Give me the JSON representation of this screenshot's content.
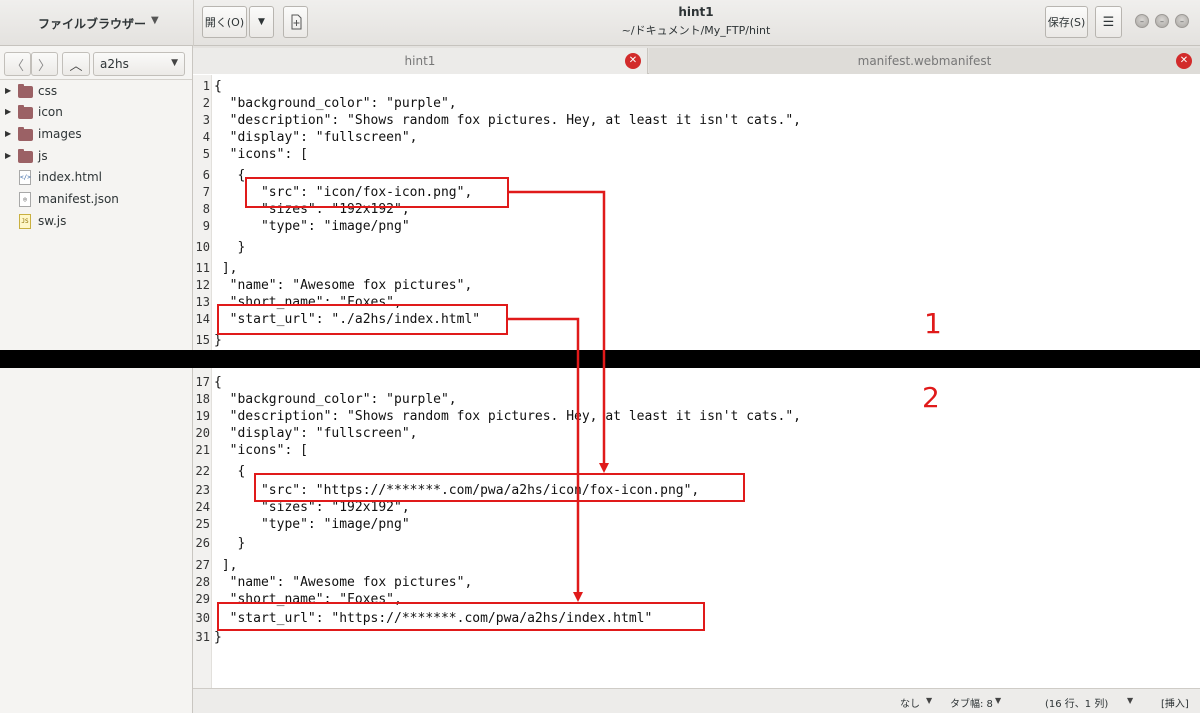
{
  "header": {
    "file_browser_title": "ファイルブラウザー",
    "open_label": "開く(O)",
    "window_title": "hint1",
    "window_path": "~/ドキュメント/My_FTP/hint",
    "save_label": "保存(S)"
  },
  "sidepanel": {
    "location": "a2hs",
    "items": [
      {
        "label": "css",
        "type": "folder"
      },
      {
        "label": "icon",
        "type": "folder"
      },
      {
        "label": "images",
        "type": "folder"
      },
      {
        "label": "js",
        "type": "folder"
      },
      {
        "label": "index.html",
        "type": "html"
      },
      {
        "label": "manifest.json",
        "type": "json"
      },
      {
        "label": "sw.js",
        "type": "js"
      }
    ]
  },
  "tabs": [
    {
      "label": "hint1"
    },
    {
      "label": "manifest.webmanifest"
    }
  ],
  "code_top": [
    {
      "n": "1",
      "t": "{"
    },
    {
      "n": "2",
      "t": "  \"background_color\": \"purple\","
    },
    {
      "n": "3",
      "t": "  \"description\": \"Shows random fox pictures. Hey, at least it isn't cats.\","
    },
    {
      "n": "4",
      "t": "  \"display\": \"fullscreen\","
    },
    {
      "n": "5",
      "t": "  \"icons\": ["
    },
    {
      "n": "6",
      "t": "   {"
    },
    {
      "n": "7",
      "t": "      \"src\": \"icon/fox-icon.png\","
    },
    {
      "n": "8",
      "t": "      \"sizes\": \"192x192\","
    },
    {
      "n": "9",
      "t": "      \"type\": \"image/png\""
    },
    {
      "n": "10",
      "t": "   }"
    },
    {
      "n": "11",
      "t": " ],"
    },
    {
      "n": "12",
      "t": "  \"name\": \"Awesome fox pictures\","
    },
    {
      "n": "13",
      "t": "  \"short_name\": \"Foxes\","
    },
    {
      "n": "14",
      "t": "  \"start_url\": \"./a2hs/index.html\""
    },
    {
      "n": "15",
      "t": "}"
    }
  ],
  "code_bottom": [
    {
      "n": "17",
      "t": "{"
    },
    {
      "n": "18",
      "t": "  \"background_color\": \"purple\","
    },
    {
      "n": "19",
      "t": "  \"description\": \"Shows random fox pictures. Hey, at least it isn't cats.\","
    },
    {
      "n": "20",
      "t": "  \"display\": \"fullscreen\","
    },
    {
      "n": "21",
      "t": "  \"icons\": ["
    },
    {
      "n": "22",
      "t": "   {"
    },
    {
      "n": "23",
      "t": "      \"src\": \"https://*******.com/pwa/a2hs/icon/fox-icon.png\","
    },
    {
      "n": "24",
      "t": "      \"sizes\": \"192x192\","
    },
    {
      "n": "25",
      "t": "      \"type\": \"image/png\""
    },
    {
      "n": "26",
      "t": "   }"
    },
    {
      "n": "27",
      "t": " ],"
    },
    {
      "n": "28",
      "t": "  \"name\": \"Awesome fox pictures\","
    },
    {
      "n": "29",
      "t": "  \"short_name\": \"Foxes\","
    },
    {
      "n": "30",
      "t": "  \"start_url\": \"https://*******.com/pwa/a2hs/index.html\""
    },
    {
      "n": "31",
      "t": "}"
    }
  ],
  "annotations": {
    "label_1": "1",
    "label_2": "2",
    "color": "#e01a1a"
  },
  "statusbar": {
    "syntax": "なし",
    "tab_width": "タブ幅: 8",
    "position": "(16 行、1 列)",
    "mode": "[挿入]"
  }
}
